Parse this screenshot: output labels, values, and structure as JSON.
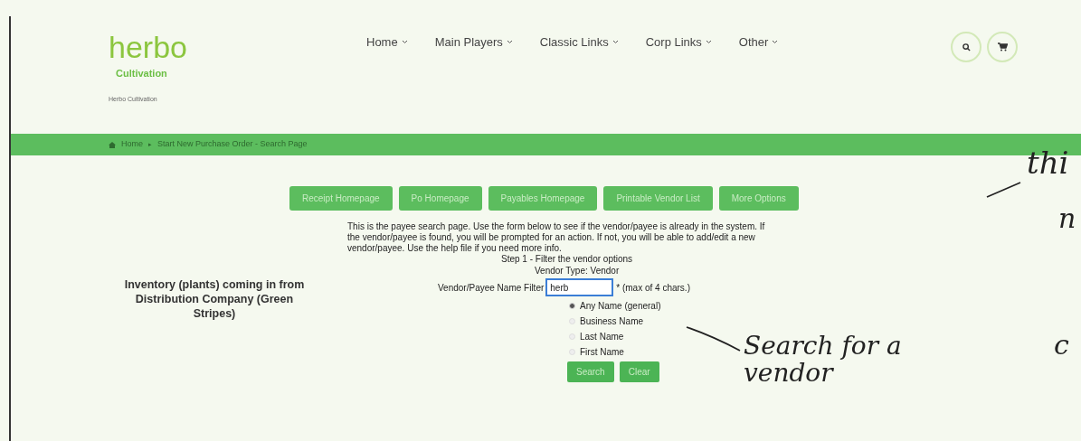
{
  "logo": {
    "wordmark": "herbo",
    "subtitle": "Cultivation"
  },
  "site_name": "Herbo Cultivation",
  "nav": [
    {
      "label": "Home"
    },
    {
      "label": "Main Players"
    },
    {
      "label": "Classic Links"
    },
    {
      "label": "Corp Links"
    },
    {
      "label": "Other"
    }
  ],
  "breadcrumb": {
    "items": [
      "Home",
      "Start New Purchase Order - Search Page"
    ],
    "separator": "▸"
  },
  "action_buttons": [
    "Receipt Homepage",
    "Po Homepage",
    "Payables Homepage",
    "Printable Vendor List",
    "More Options"
  ],
  "side_caption": "Inventory (plants) coming in from Distribution Company (Green Stripes)",
  "form": {
    "intro": "This is the payee search page. Use the form below to see if the vendor/payee is already in the system. If the vendor/payee is found, you will be prompted for an action. If not, you will be able to add/edit a new vendor/payee. Use the help file if you need more info.",
    "step": "Step 1 - Filter the vendor options",
    "vendor_type": "Vendor Type: Vendor",
    "filter_label": "Vendor/Payee Name Filter",
    "filter_value": "herb",
    "filter_hint": "* (max of 4 chars.)",
    "name_options": [
      {
        "label": "Any Name (general)",
        "selected": true
      },
      {
        "label": "Business Name",
        "selected": false
      },
      {
        "label": "Last Name",
        "selected": false
      },
      {
        "label": "First Name",
        "selected": false
      }
    ],
    "buttons": [
      "Search",
      "Clear"
    ]
  },
  "annotations": [
    {
      "text": "Search for a vendor"
    },
    {
      "text": "thi"
    },
    {
      "text": "n"
    },
    {
      "text": "c"
    }
  ]
}
